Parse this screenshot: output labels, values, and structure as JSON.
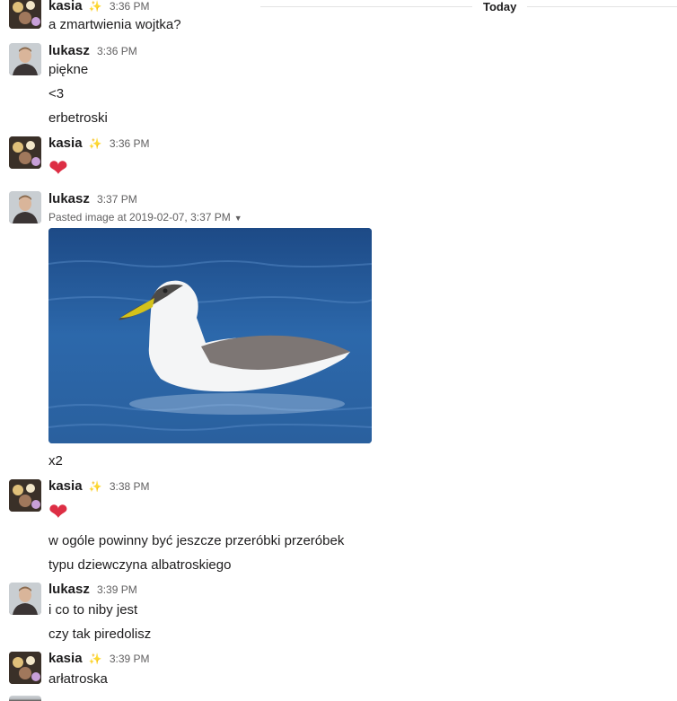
{
  "day_divider": "Today",
  "messages": [
    {
      "author": "kasia",
      "time": "3:36 PM",
      "badge": "✨",
      "lines": [
        "a zmartwienia wojtka?"
      ]
    },
    {
      "author": "lukasz",
      "time": "3:36 PM",
      "lines": [
        "piękne",
        "<3",
        "erbetroski"
      ]
    },
    {
      "author": "kasia",
      "time": "3:36 PM",
      "badge": "✨",
      "reaction": "❤"
    },
    {
      "author": "lukasz",
      "time": "3:37 PM",
      "attachment": {
        "label": "Pasted image at 2019-02-07, 3:37 PM",
        "alt": "albatross on blue water"
      },
      "lines": [
        "x2"
      ]
    },
    {
      "author": "kasia",
      "time": "3:38 PM",
      "badge": "✨",
      "reaction": "❤",
      "lines": [
        "w ogóle powinny być jeszcze przeróbki przeróbek",
        "typu dziewczyna albatroskiego"
      ]
    },
    {
      "author": "lukasz",
      "time": "3:39 PM",
      "lines": [
        "i co to niby jest",
        "czy tak piredolisz"
      ]
    },
    {
      "author": "kasia",
      "time": "3:39 PM",
      "badge": "✨",
      "lines": [
        "arłatroska"
      ]
    }
  ],
  "colors": {
    "heart": "#dd2e44",
    "water": "#2b66a8"
  }
}
